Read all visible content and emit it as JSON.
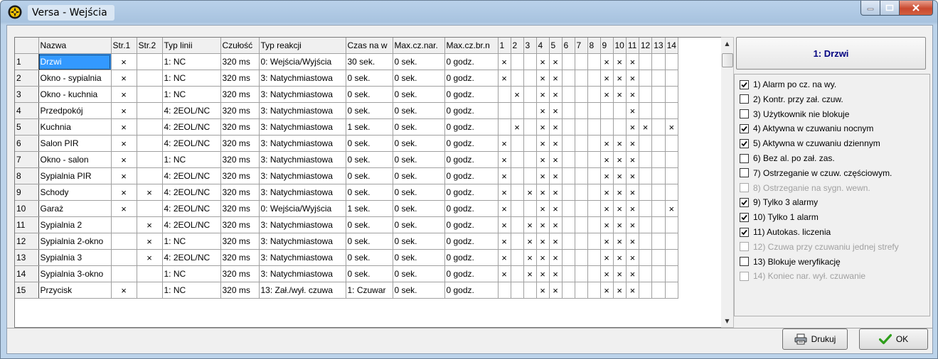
{
  "window": {
    "title": "Versa - Wejścia"
  },
  "grid": {
    "columns": [
      "",
      "Nazwa",
      "Str.1",
      "Str.2",
      "Typ linii",
      "Czułość",
      "Typ reakcji",
      "Czas na w",
      "Max.cz.nar.",
      "Max.cz.br.n",
      "1",
      "2",
      "3",
      "4",
      "5",
      "6",
      "7",
      "8",
      "9",
      "10",
      "11",
      "12",
      "13",
      "14"
    ],
    "rows": [
      [
        "1",
        "Drzwi",
        "×",
        "",
        "1: NC",
        "320 ms",
        "0: Wejścia/Wyjścia",
        "30 sek.",
        "0 sek.",
        "0 godz.",
        "×",
        "",
        "",
        "×",
        "×",
        "",
        "",
        "",
        "×",
        "×",
        "×",
        "",
        "",
        ""
      ],
      [
        "2",
        "Okno - sypialnia",
        "×",
        "",
        "1: NC",
        "320 ms",
        "3: Natychmiastowa",
        "0 sek.",
        "0 sek.",
        "0 godz.",
        "×",
        "",
        "",
        "×",
        "×",
        "",
        "",
        "",
        "×",
        "×",
        "×",
        "",
        "",
        ""
      ],
      [
        "3",
        "Okno - kuchnia",
        "×",
        "",
        "1: NC",
        "320 ms",
        "3: Natychmiastowa",
        "0 sek.",
        "0 sek.",
        "0 godz.",
        "",
        "×",
        "",
        "×",
        "×",
        "",
        "",
        "",
        "×",
        "×",
        "×",
        "",
        "",
        ""
      ],
      [
        "4",
        "Przedpokój",
        "×",
        "",
        "4: 2EOL/NC",
        "320 ms",
        "3: Natychmiastowa",
        "0 sek.",
        "0 sek.",
        "0 godz.",
        "",
        "",
        "",
        "×",
        "×",
        "",
        "",
        "",
        "",
        "",
        "×",
        "",
        "",
        ""
      ],
      [
        "5",
        "Kuchnia",
        "×",
        "",
        "4: 2EOL/NC",
        "320 ms",
        "3: Natychmiastowa",
        "1 sek.",
        "0 sek.",
        "0 godz.",
        "",
        "×",
        "",
        "×",
        "×",
        "",
        "",
        "",
        "",
        "",
        "×",
        "×",
        "",
        "×"
      ],
      [
        "6",
        "Salon PIR",
        "×",
        "",
        "4: 2EOL/NC",
        "320 ms",
        "3: Natychmiastowa",
        "0 sek.",
        "0 sek.",
        "0 godz.",
        "×",
        "",
        "",
        "×",
        "×",
        "",
        "",
        "",
        "×",
        "×",
        "×",
        "",
        "",
        ""
      ],
      [
        "7",
        "Okno - salon",
        "×",
        "",
        "1: NC",
        "320 ms",
        "3: Natychmiastowa",
        "0 sek.",
        "0 sek.",
        "0 godz.",
        "×",
        "",
        "",
        "×",
        "×",
        "",
        "",
        "",
        "×",
        "×",
        "×",
        "",
        "",
        ""
      ],
      [
        "8",
        "Sypialnia PIR",
        "×",
        "",
        "4: 2EOL/NC",
        "320 ms",
        "3: Natychmiastowa",
        "0 sek.",
        "0 sek.",
        "0 godz.",
        "×",
        "",
        "",
        "×",
        "×",
        "",
        "",
        "",
        "×",
        "×",
        "×",
        "",
        "",
        ""
      ],
      [
        "9",
        "Schody",
        "×",
        "×",
        "4: 2EOL/NC",
        "320 ms",
        "3: Natychmiastowa",
        "0 sek.",
        "0 sek.",
        "0 godz.",
        "×",
        "",
        "×",
        "×",
        "×",
        "",
        "",
        "",
        "×",
        "×",
        "×",
        "",
        "",
        ""
      ],
      [
        "10",
        "Garaż",
        "×",
        "",
        "4: 2EOL/NC",
        "320 ms",
        "0: Wejścia/Wyjścia",
        "1 sek.",
        "0 sek.",
        "0 godz.",
        "×",
        "",
        "",
        "×",
        "×",
        "",
        "",
        "",
        "×",
        "×",
        "×",
        "",
        "",
        "×"
      ],
      [
        "11",
        "Sypialnia 2",
        "",
        "×",
        "4: 2EOL/NC",
        "320 ms",
        "3: Natychmiastowa",
        "0 sek.",
        "0 sek.",
        "0 godz.",
        "×",
        "",
        "×",
        "×",
        "×",
        "",
        "",
        "",
        "×",
        "×",
        "×",
        "",
        "",
        ""
      ],
      [
        "12",
        "Sypialnia 2-okno",
        "",
        "×",
        "1: NC",
        "320 ms",
        "3: Natychmiastowa",
        "0 sek.",
        "0 sek.",
        "0 godz.",
        "×",
        "",
        "×",
        "×",
        "×",
        "",
        "",
        "",
        "×",
        "×",
        "×",
        "",
        "",
        ""
      ],
      [
        "13",
        "Sypialnia 3",
        "",
        "×",
        "4: 2EOL/NC",
        "320 ms",
        "3: Natychmiastowa",
        "0 sek.",
        "0 sek.",
        "0 godz.",
        "×",
        "",
        "×",
        "×",
        "×",
        "",
        "",
        "",
        "×",
        "×",
        "×",
        "",
        "",
        ""
      ],
      [
        "14",
        "Sypialnia 3-okno",
        "",
        "",
        "1: NC",
        "320 ms",
        "3: Natychmiastowa",
        "0 sek.",
        "0 sek.",
        "0 godz.",
        "×",
        "",
        "×",
        "×",
        "×",
        "",
        "",
        "",
        "×",
        "×",
        "×",
        "",
        "",
        ""
      ],
      [
        "15",
        "Przycisk",
        "×",
        "",
        "1: NC",
        "320 ms",
        "13: Zał./wył. czuwa",
        "1: Czuwar",
        "0 sek.",
        "0 godz.",
        "",
        "",
        "",
        "×",
        "×",
        "",
        "",
        "",
        "×",
        "×",
        "×",
        "",
        "",
        ""
      ]
    ]
  },
  "details": {
    "selected_title": "1: Drzwi",
    "options": [
      {
        "label": "1) Alarm po cz. na wy.",
        "checked": true,
        "enabled": true
      },
      {
        "label": "2) Kontr. przy zał. czuw.",
        "checked": false,
        "enabled": true
      },
      {
        "label": "3) Użytkownik nie blokuje",
        "checked": false,
        "enabled": true
      },
      {
        "label": "4) Aktywna w czuwaniu nocnym",
        "checked": true,
        "enabled": true
      },
      {
        "label": "5) Aktywna w czuwaniu dziennym",
        "checked": true,
        "enabled": true
      },
      {
        "label": "6) Bez al. po zał. zas.",
        "checked": false,
        "enabled": true
      },
      {
        "label": "7) Ostrzeganie w czuw. częściowym.",
        "checked": false,
        "enabled": true
      },
      {
        "label": "8) Ostrzeganie na sygn. wewn.",
        "checked": false,
        "enabled": false
      },
      {
        "label": "9) Tylko 3 alarmy",
        "checked": true,
        "enabled": true
      },
      {
        "label": "10) Tylko 1 alarm",
        "checked": true,
        "enabled": true
      },
      {
        "label": "11) Autokas. liczenia",
        "checked": true,
        "enabled": true
      },
      {
        "label": "12) Czuwa przy czuwaniu jednej strefy",
        "checked": false,
        "enabled": false
      },
      {
        "label": "13) Blokuje weryfikację",
        "checked": false,
        "enabled": true
      },
      {
        "label": "14) Koniec nar. wył. czuwanie",
        "checked": false,
        "enabled": false
      }
    ]
  },
  "buttons": {
    "print_label": "Drukuj",
    "ok_label": "OK"
  },
  "colors": {
    "selection": "#3399ff",
    "title_accent": "#000080",
    "ok_check": "#2e9e1b"
  }
}
